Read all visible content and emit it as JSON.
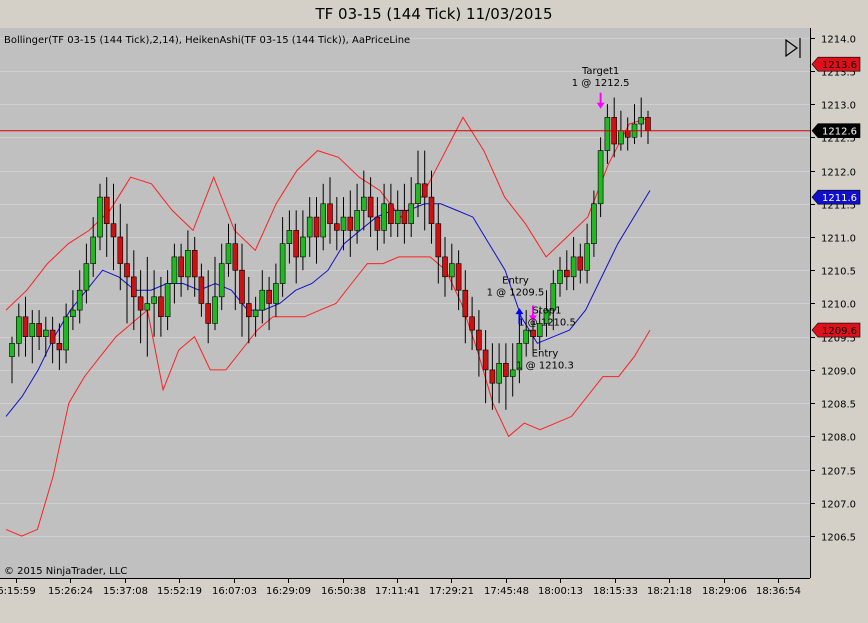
{
  "window": {
    "title": "TF 03-15 (144 Tick)  11/03/2015"
  },
  "indicator_label": "Bollinger(TF 03-15 (144 Tick),2,14), HeikenAshi(TF 03-15 (144 Tick)), AaPriceLine",
  "copyright": "© 2015 NinjaTrader, LLC",
  "colors": {
    "background": "#c0c0c0",
    "bull": "#22b822",
    "bear": "#cc1111",
    "bollinger": "#ff2020",
    "middle_band": "#1010cc",
    "price_line": "#d40000",
    "marker_sell": "#ff00ff",
    "marker_buy": "#0000ff"
  },
  "chart_data": {
    "type": "candlestick",
    "y_range": [
      1206.2,
      1214.1
    ],
    "y_ticks": [
      "1214.0",
      "1213.5",
      "1213.0",
      "1212.5",
      "1212.0",
      "1211.5",
      "1211.0",
      "1210.5",
      "1210.0",
      "1209.5",
      "1209.0",
      "1208.5",
      "1208.0",
      "1207.5",
      "1207.0",
      "1206.5"
    ],
    "x_labels": [
      "6:15:59",
      "15:26:24",
      "15:37:08",
      "15:52:19",
      "16:07:03",
      "16:29:09",
      "16:50:38",
      "17:11:41",
      "17:29:21",
      "17:45:48",
      "18:00:13",
      "18:15:33",
      "18:21:18",
      "18:29:06",
      "18:36:54"
    ],
    "price_labels": [
      {
        "value": 1213.6,
        "text": "1213.6",
        "style": "red"
      },
      {
        "value": 1212.6,
        "text": "1212.6",
        "style": "black"
      },
      {
        "value": 1211.6,
        "text": "1211.6",
        "style": "blue"
      },
      {
        "value": 1209.6,
        "text": "1209.6",
        "style": "red"
      }
    ],
    "price_line": 1212.6,
    "candles": [
      [
        1209.2,
        1209.4,
        1209.5,
        1208.8
      ],
      [
        1209.4,
        1209.8,
        1210.0,
        1209.2
      ],
      [
        1209.8,
        1209.5,
        1210.1,
        1209.2
      ],
      [
        1209.5,
        1209.7,
        1209.9,
        1209.1
      ],
      [
        1209.7,
        1209.5,
        1209.9,
        1209.3
      ],
      [
        1209.5,
        1209.6,
        1209.8,
        1209.2
      ],
      [
        1209.6,
        1209.4,
        1209.8,
        1209.1
      ],
      [
        1209.4,
        1209.3,
        1209.7,
        1209.0
      ],
      [
        1209.3,
        1209.8,
        1210.0,
        1209.1
      ],
      [
        1209.8,
        1209.9,
        1210.2,
        1209.6
      ],
      [
        1209.9,
        1210.2,
        1210.5,
        1209.7
      ],
      [
        1210.2,
        1210.6,
        1210.9,
        1210.0
      ],
      [
        1210.6,
        1211.0,
        1211.3,
        1210.4
      ],
      [
        1211.0,
        1211.6,
        1211.8,
        1210.8
      ],
      [
        1211.6,
        1211.2,
        1211.9,
        1210.7
      ],
      [
        1211.2,
        1211.0,
        1211.8,
        1210.5
      ],
      [
        1211.0,
        1210.6,
        1211.5,
        1210.2
      ],
      [
        1210.6,
        1210.4,
        1211.2,
        1209.7
      ],
      [
        1210.4,
        1210.1,
        1210.8,
        1209.6
      ],
      [
        1210.1,
        1209.9,
        1210.5,
        1209.4
      ],
      [
        1209.9,
        1210.0,
        1210.7,
        1209.2
      ],
      [
        1210.0,
        1210.1,
        1210.5,
        1209.5
      ],
      [
        1210.1,
        1209.8,
        1210.4,
        1209.5
      ],
      [
        1209.8,
        1210.3,
        1210.5,
        1209.6
      ],
      [
        1210.3,
        1210.7,
        1210.9,
        1210.0
      ],
      [
        1210.7,
        1210.4,
        1210.9,
        1210.1
      ],
      [
        1210.4,
        1210.8,
        1211.1,
        1210.2
      ],
      [
        1210.8,
        1210.4,
        1211.0,
        1210.1
      ],
      [
        1210.4,
        1210.0,
        1210.6,
        1209.8
      ],
      [
        1210.0,
        1209.7,
        1210.5,
        1209.4
      ],
      [
        1209.7,
        1210.1,
        1210.7,
        1209.6
      ],
      [
        1210.1,
        1210.6,
        1210.9,
        1209.9
      ],
      [
        1210.6,
        1210.9,
        1211.2,
        1210.4
      ],
      [
        1210.9,
        1210.5,
        1211.2,
        1209.9
      ],
      [
        1210.5,
        1210.0,
        1210.9,
        1209.5
      ],
      [
        1210.0,
        1209.8,
        1210.4,
        1209.4
      ],
      [
        1209.8,
        1209.9,
        1210.1,
        1209.5
      ],
      [
        1209.9,
        1210.2,
        1210.5,
        1209.7
      ],
      [
        1210.2,
        1210.0,
        1210.4,
        1209.6
      ],
      [
        1210.0,
        1210.3,
        1210.6,
        1209.8
      ],
      [
        1210.3,
        1210.9,
        1211.3,
        1210.1
      ],
      [
        1210.9,
        1211.1,
        1211.4,
        1210.6
      ],
      [
        1211.1,
        1210.7,
        1211.4,
        1210.3
      ],
      [
        1210.7,
        1211.0,
        1211.4,
        1210.5
      ],
      [
        1211.0,
        1211.3,
        1211.6,
        1210.7
      ],
      [
        1211.3,
        1211.0,
        1211.6,
        1210.6
      ],
      [
        1211.0,
        1211.5,
        1211.8,
        1210.8
      ],
      [
        1211.5,
        1211.2,
        1211.9,
        1210.9
      ],
      [
        1211.2,
        1211.1,
        1211.6,
        1210.8
      ],
      [
        1211.1,
        1211.3,
        1211.6,
        1210.8
      ],
      [
        1211.3,
        1211.1,
        1211.7,
        1210.7
      ],
      [
        1211.1,
        1211.4,
        1211.8,
        1210.9
      ],
      [
        1211.4,
        1211.6,
        1212.0,
        1211.1
      ],
      [
        1211.6,
        1211.3,
        1211.9,
        1211.0
      ],
      [
        1211.3,
        1211.1,
        1211.6,
        1210.8
      ],
      [
        1211.1,
        1211.5,
        1211.8,
        1210.9
      ],
      [
        1211.5,
        1211.2,
        1211.8,
        1211.0
      ],
      [
        1211.2,
        1211.4,
        1211.7,
        1211.0
      ],
      [
        1211.4,
        1211.2,
        1211.8,
        1210.9
      ],
      [
        1211.2,
        1211.5,
        1211.9,
        1211.0
      ],
      [
        1211.5,
        1211.8,
        1212.3,
        1211.3
      ],
      [
        1211.8,
        1211.6,
        1212.3,
        1211.1
      ],
      [
        1211.6,
        1211.2,
        1212.0,
        1210.9
      ],
      [
        1211.2,
        1210.7,
        1211.5,
        1210.3
      ],
      [
        1210.7,
        1210.4,
        1211.0,
        1210.1
      ],
      [
        1210.4,
        1210.6,
        1210.9,
        1210.2
      ],
      [
        1210.6,
        1210.2,
        1210.8,
        1209.9
      ],
      [
        1210.2,
        1209.8,
        1210.5,
        1209.4
      ],
      [
        1209.8,
        1209.6,
        1210.1,
        1209.3
      ],
      [
        1209.6,
        1209.3,
        1209.9,
        1208.9
      ],
      [
        1209.3,
        1209.0,
        1209.6,
        1208.5
      ],
      [
        1209.0,
        1208.8,
        1209.4,
        1208.4
      ],
      [
        1208.8,
        1209.1,
        1209.4,
        1208.5
      ],
      [
        1209.1,
        1208.9,
        1209.4,
        1208.4
      ],
      [
        1208.9,
        1209.0,
        1209.4,
        1208.6
      ],
      [
        1209.0,
        1209.4,
        1209.7,
        1208.8
      ],
      [
        1209.4,
        1209.6,
        1209.9,
        1209.2
      ],
      [
        1209.6,
        1209.5,
        1209.8,
        1209.3
      ],
      [
        1209.5,
        1209.7,
        1209.9,
        1209.3
      ],
      [
        1209.7,
        1209.9,
        1210.2,
        1209.5
      ],
      [
        1209.9,
        1210.3,
        1210.5,
        1209.6
      ],
      [
        1210.3,
        1210.5,
        1210.7,
        1210.1
      ],
      [
        1210.5,
        1210.4,
        1210.8,
        1210.2
      ],
      [
        1210.4,
        1210.7,
        1211.0,
        1210.2
      ],
      [
        1210.7,
        1210.5,
        1210.9,
        1210.3
      ],
      [
        1210.5,
        1210.9,
        1211.2,
        1210.3
      ],
      [
        1210.9,
        1211.5,
        1211.7,
        1210.7
      ],
      [
        1211.5,
        1212.3,
        1212.5,
        1211.3
      ],
      [
        1212.3,
        1212.8,
        1213.0,
        1212.1
      ],
      [
        1212.8,
        1212.4,
        1213.1,
        1212.2
      ],
      [
        1212.4,
        1212.6,
        1212.9,
        1212.3
      ],
      [
        1212.6,
        1212.5,
        1212.8,
        1212.3
      ],
      [
        1212.5,
        1212.7,
        1213.0,
        1212.4
      ],
      [
        1212.7,
        1212.8,
        1213.1,
        1212.5
      ],
      [
        1212.8,
        1212.6,
        1212.9,
        1212.4
      ]
    ],
    "bollinger_upper": [
      1209.9,
      1210.2,
      1210.6,
      1210.9,
      1211.1,
      1211.4,
      1211.9,
      1211.8,
      1211.4,
      1211.1,
      1211.9,
      1211.1,
      1210.8,
      1211.5,
      1212.0,
      1212.3,
      1212.2,
      1211.9,
      1211.7,
      1211.3,
      1211.6,
      1212.2,
      1212.8,
      1212.3,
      1211.6,
      1211.2,
      1210.7,
      1211.0,
      1211.3,
      1212.1,
      1212.7,
      1212.8
    ],
    "bollinger_lower": [
      1206.6,
      1206.5,
      1206.6,
      1207.4,
      1208.5,
      1208.9,
      1209.2,
      1209.5,
      1209.7,
      1209.9,
      1208.7,
      1209.3,
      1209.5,
      1209.0,
      1209.0,
      1209.3,
      1209.6,
      1209.8,
      1209.8,
      1209.8,
      1209.9,
      1210.0,
      1210.3,
      1210.6,
      1210.6,
      1210.7,
      1210.7,
      1210.7,
      1210.5,
      1210.0,
      1209.3,
      1208.5,
      1208.0,
      1208.2,
      1208.1,
      1208.2,
      1208.3,
      1208.6,
      1208.9,
      1208.9,
      1209.2,
      1209.6
    ],
    "bollinger_middle": [
      1208.3,
      1208.6,
      1209.0,
      1209.5,
      1209.9,
      1210.2,
      1210.5,
      1210.4,
      1210.2,
      1210.2,
      1210.3,
      1210.3,
      1210.2,
      1210.3,
      1210.2,
      1209.9,
      1209.9,
      1210.0,
      1210.2,
      1210.3,
      1210.5,
      1210.9,
      1211.1,
      1211.3,
      1211.4,
      1211.4,
      1211.5,
      1211.5,
      1211.4,
      1211.3,
      1210.9,
      1210.5,
      1209.8,
      1209.4,
      1209.5,
      1209.6,
      1209.9,
      1210.4,
      1210.9,
      1211.3,
      1211.7
    ],
    "annotations": [
      {
        "label": "Target1",
        "sublabel": "1 @ 1212.5"
      },
      {
        "label": "Entry",
        "sublabel": "1 @ 1209.5"
      },
      {
        "label": "Stop1",
        "sublabel": "1 @ 1210.5"
      },
      {
        "label": "Entry",
        "sublabel": "1 @ 1210.3"
      }
    ]
  }
}
